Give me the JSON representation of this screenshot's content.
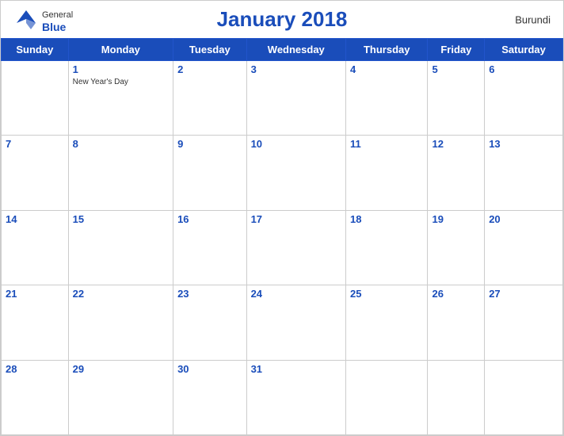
{
  "header": {
    "logo_general": "General",
    "logo_blue": "Blue",
    "title": "January 2018",
    "country": "Burundi"
  },
  "days_of_week": [
    "Sunday",
    "Monday",
    "Tuesday",
    "Wednesday",
    "Thursday",
    "Friday",
    "Saturday"
  ],
  "weeks": [
    [
      {
        "date": "",
        "holiday": ""
      },
      {
        "date": "1",
        "holiday": "New Year's Day"
      },
      {
        "date": "2",
        "holiday": ""
      },
      {
        "date": "3",
        "holiday": ""
      },
      {
        "date": "4",
        "holiday": ""
      },
      {
        "date": "5",
        "holiday": ""
      },
      {
        "date": "6",
        "holiday": ""
      }
    ],
    [
      {
        "date": "7",
        "holiday": ""
      },
      {
        "date": "8",
        "holiday": ""
      },
      {
        "date": "9",
        "holiday": ""
      },
      {
        "date": "10",
        "holiday": ""
      },
      {
        "date": "11",
        "holiday": ""
      },
      {
        "date": "12",
        "holiday": ""
      },
      {
        "date": "13",
        "holiday": ""
      }
    ],
    [
      {
        "date": "14",
        "holiday": ""
      },
      {
        "date": "15",
        "holiday": ""
      },
      {
        "date": "16",
        "holiday": ""
      },
      {
        "date": "17",
        "holiday": ""
      },
      {
        "date": "18",
        "holiday": ""
      },
      {
        "date": "19",
        "holiday": ""
      },
      {
        "date": "20",
        "holiday": ""
      }
    ],
    [
      {
        "date": "21",
        "holiday": ""
      },
      {
        "date": "22",
        "holiday": ""
      },
      {
        "date": "23",
        "holiday": ""
      },
      {
        "date": "24",
        "holiday": ""
      },
      {
        "date": "25",
        "holiday": ""
      },
      {
        "date": "26",
        "holiday": ""
      },
      {
        "date": "27",
        "holiday": ""
      }
    ],
    [
      {
        "date": "28",
        "holiday": ""
      },
      {
        "date": "29",
        "holiday": ""
      },
      {
        "date": "30",
        "holiday": ""
      },
      {
        "date": "31",
        "holiday": ""
      },
      {
        "date": "",
        "holiday": ""
      },
      {
        "date": "",
        "holiday": ""
      },
      {
        "date": "",
        "holiday": ""
      }
    ]
  ],
  "colors": {
    "blue": "#1a4dba",
    "header_bg": "#1a4dba",
    "border": "#aab"
  }
}
